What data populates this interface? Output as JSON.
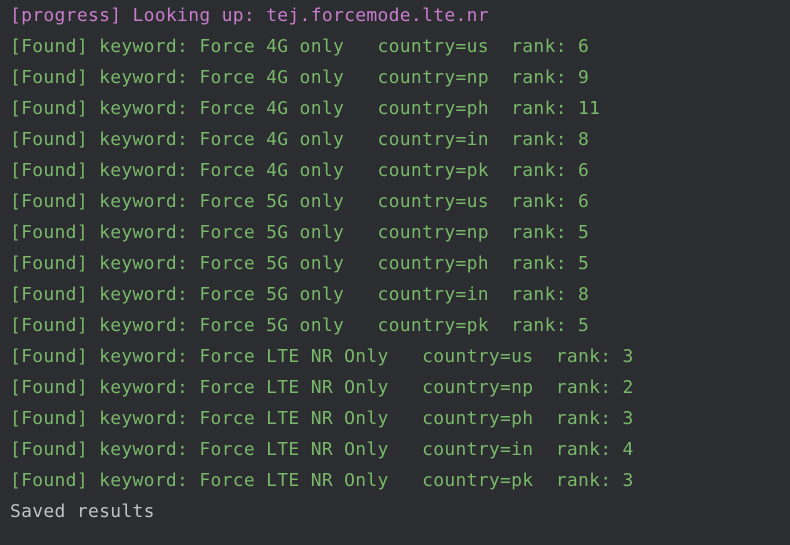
{
  "terminal": {
    "progress_line": "[progress] Looking up: tej.forcemode.lte.nr",
    "results": [
      "[Found] keyword: Force 4G only   country=us  rank: 6",
      "[Found] keyword: Force 4G only   country=np  rank: 9",
      "[Found] keyword: Force 4G only   country=ph  rank: 11",
      "[Found] keyword: Force 4G only   country=in  rank: 8",
      "[Found] keyword: Force 4G only   country=pk  rank: 6",
      "[Found] keyword: Force 5G only   country=us  rank: 6",
      "[Found] keyword: Force 5G only   country=np  rank: 5",
      "[Found] keyword: Force 5G only   country=ph  rank: 5",
      "[Found] keyword: Force 5G only   country=in  rank: 8",
      "[Found] keyword: Force 5G only   country=pk  rank: 5",
      "[Found] keyword: Force LTE NR Only   country=us  rank: 3",
      "[Found] keyword: Force LTE NR Only   country=np  rank: 2",
      "[Found] keyword: Force LTE NR Only   country=ph  rank: 3",
      "[Found] keyword: Force LTE NR Only   country=in  rank: 4",
      "[Found] keyword: Force LTE NR Only   country=pk  rank: 3"
    ],
    "saved_line": "Saved results"
  },
  "colors": {
    "background": "#2b2d30",
    "progress": "#c77dcc",
    "found": "#79b86a",
    "saved": "#c0c2c6"
  }
}
